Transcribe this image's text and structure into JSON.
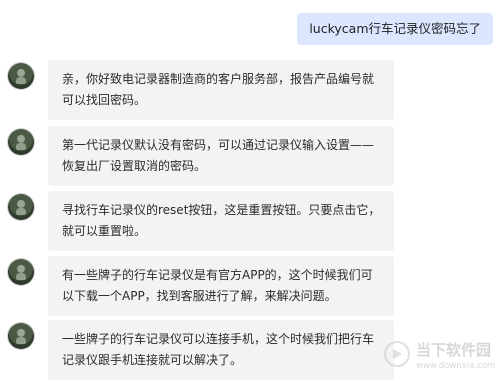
{
  "user_message": "luckycam行车记录仪密码忘了",
  "replies": [
    {
      "text": "亲，你好致电记录器制造商的客户服务部，报告产品编号就可以找回密码。"
    },
    {
      "text": "第一代记录仪默认没有密码，可以通过记录仪输入设置——恢复出厂设置取消的密码。"
    },
    {
      "text": "寻找行车记录仪的reset按钮，这是重置按钮。只要点击它，就可以重置啦。"
    },
    {
      "text": "有一些牌子的行车记录仪是有官方APP的，这个时候我们可以下载一个APP，找到客服进行了解，来解决问题。"
    },
    {
      "text": "一些牌子的行车记录仪可以连接手机，这个时候我们把行车记录仪跟手机连接就可以解决了。"
    }
  ],
  "watermark": {
    "title": "当下软件园",
    "url": "www.downxia.com"
  }
}
